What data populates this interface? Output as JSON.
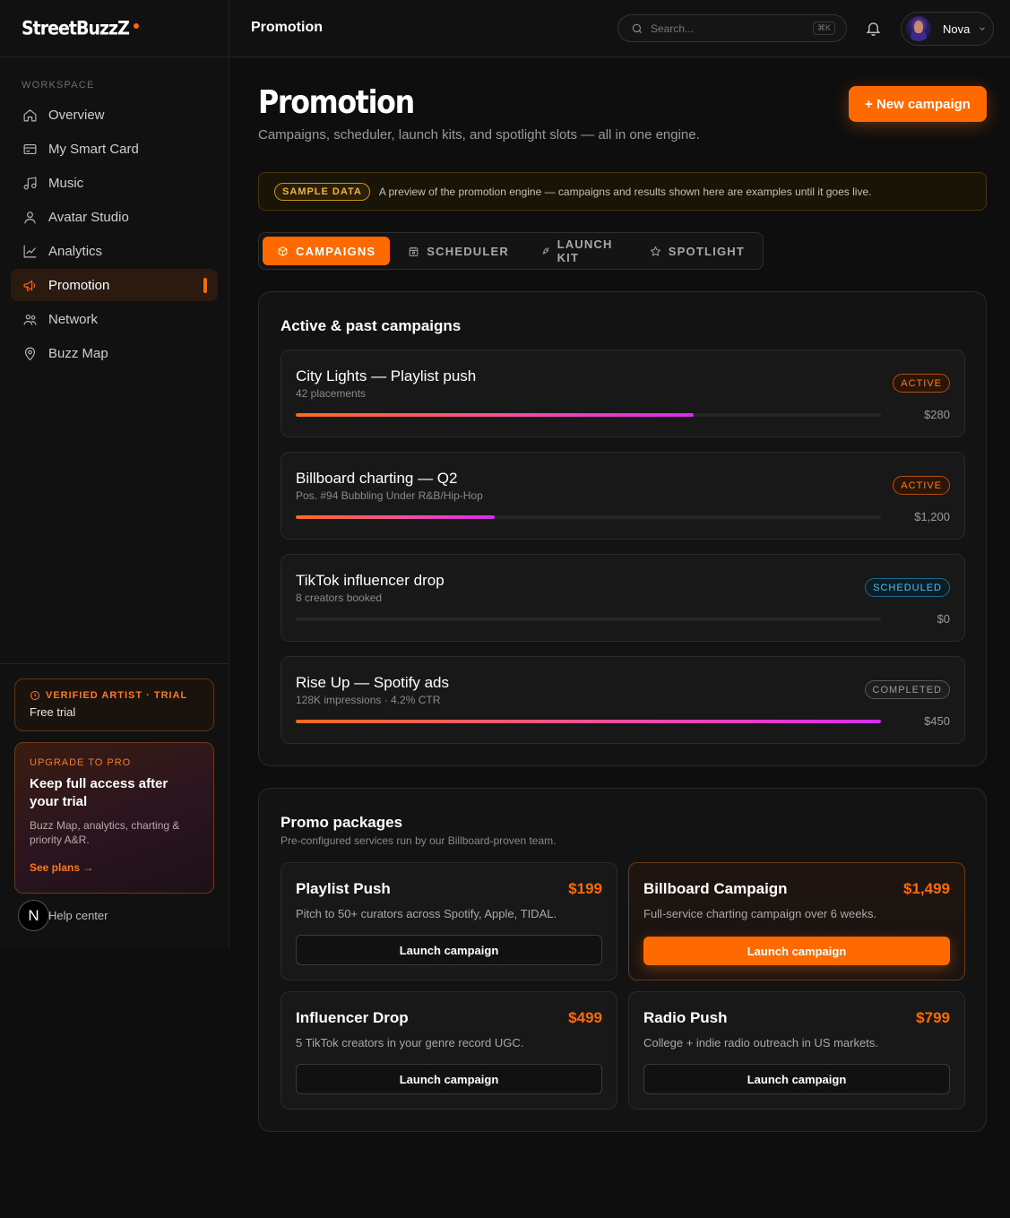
{
  "app": {
    "brand": "StreetBuzzZ",
    "accent": "#ff6a00"
  },
  "sidebar": {
    "section_label": "WORKSPACE",
    "items": [
      {
        "label": "Overview",
        "icon": "home-icon"
      },
      {
        "label": "My Smart Card",
        "icon": "card-icon"
      },
      {
        "label": "Music",
        "icon": "music-icon"
      },
      {
        "label": "Avatar Studio",
        "icon": "user-icon"
      },
      {
        "label": "Analytics",
        "icon": "chart-line-icon"
      },
      {
        "label": "Promotion",
        "icon": "megaphone-icon",
        "active": true
      },
      {
        "label": "Network",
        "icon": "network-icon"
      },
      {
        "label": "Buzz Map",
        "icon": "map-pin-icon"
      }
    ],
    "trial": {
      "title": "VERIFIED ARTIST · TRIAL",
      "sub": "Free trial"
    },
    "upgrade": {
      "eyebrow": "UPGRADE TO PRO",
      "title": "Keep full access after your trial",
      "desc": "Buzz Map, analytics, charting & priority A&R.",
      "link": "See plans →"
    },
    "help": {
      "badge": "N",
      "label": "Help center"
    }
  },
  "topbar": {
    "title": "Promotion",
    "search_placeholder": "Search...",
    "shortcut": "⌘K",
    "user_name": "Nova"
  },
  "page": {
    "title": "Promotion",
    "subtitle": "Campaigns, scheduler, launch kits, and spotlight slots — all in one engine.",
    "new_button": "+ New campaign",
    "sample_badge": "SAMPLE DATA",
    "sample_text": "A preview of the promotion engine — campaigns and results shown here are examples until it goes live."
  },
  "tabs": [
    {
      "label": "CAMPAIGNS",
      "icon": "cube-icon",
      "active": true
    },
    {
      "label": "SCHEDULER",
      "icon": "calendar-icon"
    },
    {
      "label": "LAUNCH KIT",
      "icon": "rocket-icon"
    },
    {
      "label": "SPOTLIGHT",
      "icon": "star-icon"
    }
  ],
  "campaigns": {
    "title": "Active & past campaigns",
    "items": [
      {
        "name": "City Lights — Playlist push",
        "meta": "42 placements",
        "status": "ACTIVE",
        "status_kind": "active",
        "progress": 0.68,
        "amount": "$280"
      },
      {
        "name": "Billboard charting — Q2",
        "meta": "Pos. #94 Bubbling Under R&B/Hip-Hop",
        "status": "ACTIVE",
        "status_kind": "active",
        "progress": 0.34,
        "amount": "$1,200"
      },
      {
        "name": "TikTok influencer drop",
        "meta": "8 creators booked",
        "status": "SCHEDULED",
        "status_kind": "scheduled",
        "progress": 0,
        "amount": "$0"
      },
      {
        "name": "Rise Up — Spotify ads",
        "meta": "128K impressions · 4.2% CTR",
        "status": "COMPLETED",
        "status_kind": "completed",
        "progress": 1.0,
        "amount": "$450"
      }
    ]
  },
  "packages": {
    "title": "Promo packages",
    "subtitle": "Pre-configured services run by our Billboard-proven team.",
    "items": [
      {
        "name": "Playlist Push",
        "price": "$199",
        "desc": "Pitch to 50+ curators across Spotify, Apple, TIDAL.",
        "button": "Launch campaign",
        "featured": false
      },
      {
        "name": "Billboard Campaign",
        "price": "$1,499",
        "desc": "Full-service charting campaign over 6 weeks.",
        "button": "Launch campaign",
        "featured": true
      },
      {
        "name": "Influencer Drop",
        "price": "$499",
        "desc": "5 TikTok creators in your genre record UGC.",
        "button": "Launch campaign",
        "featured": false
      },
      {
        "name": "Radio Push",
        "price": "$799",
        "desc": "College + indie radio outreach in US markets.",
        "button": "Launch campaign",
        "featured": false
      }
    ]
  }
}
